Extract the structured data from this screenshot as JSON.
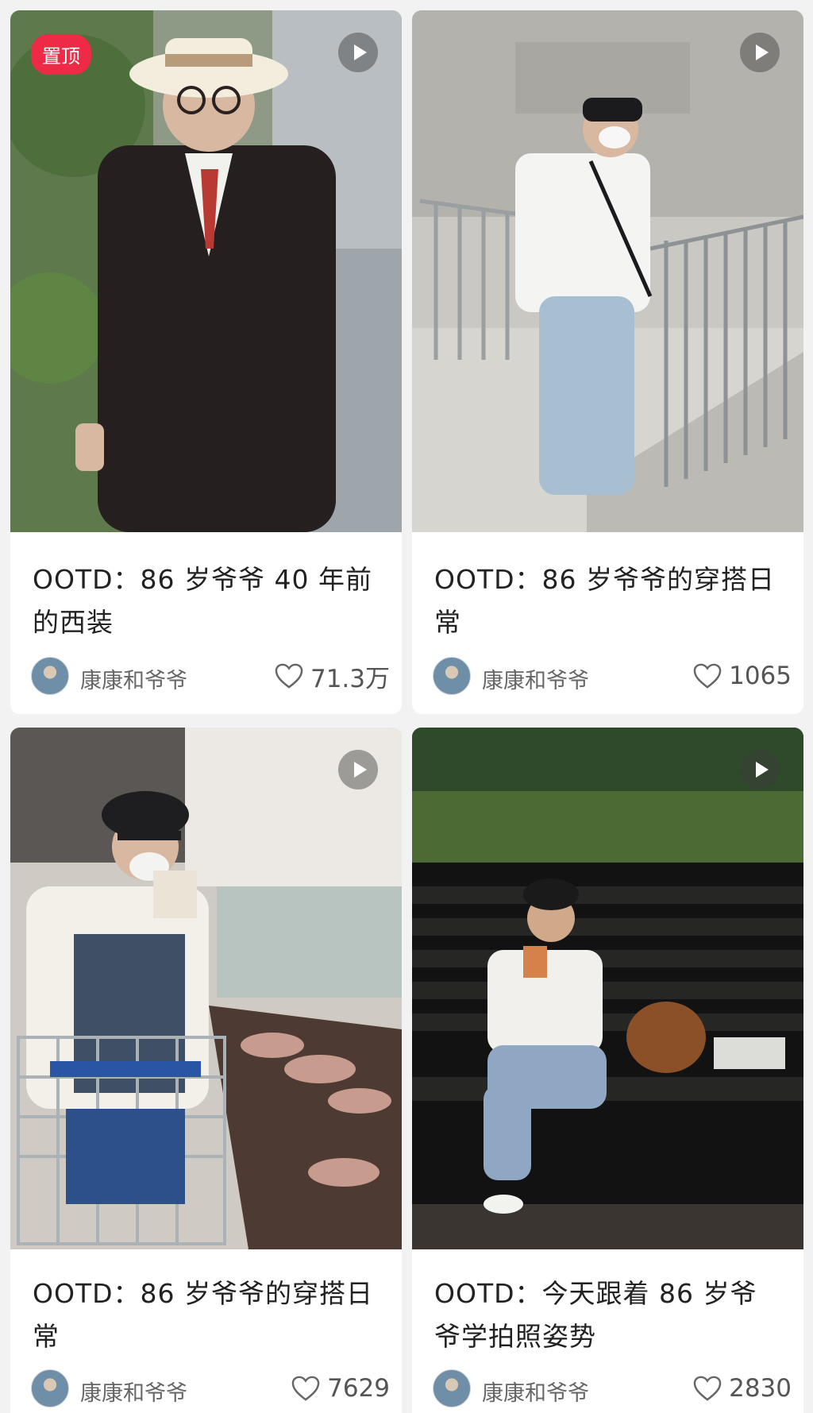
{
  "feed": {
    "cards": [
      {
        "pin_label": "置顶",
        "title": "OOTD：86 岁爷爷 40 年前的西装",
        "author": "康康和爷爷",
        "likes": "71.3万",
        "has_video": true,
        "pinned": true
      },
      {
        "title": "OOTD：86 岁爷爷的穿搭日常",
        "author": "康康和爷爷",
        "likes": "1065",
        "has_video": true
      },
      {
        "title": "OOTD：86 岁爷爷的穿搭日常",
        "author": "康康和爷爷",
        "likes": "7629",
        "has_video": true
      },
      {
        "title": "OOTD：今天跟着 86 岁爷爷学拍照姿势",
        "author": "康康和爷爷",
        "likes": "2830",
        "has_video": true
      }
    ]
  },
  "colors": {
    "pin_badge": "#ee2b47",
    "background": "#f2f2f2",
    "card": "#ffffff"
  },
  "icons": {
    "video": "play-icon",
    "like": "heart-icon",
    "avatar": "avatar"
  }
}
